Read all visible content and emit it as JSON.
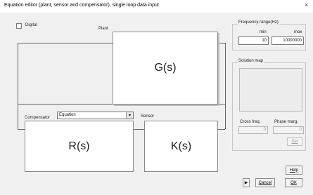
{
  "window": {
    "title": "Equation editor (plant, sensor and compensator), single loop data input",
    "close_glyph": "×"
  },
  "options": {
    "digital_label": "Digital",
    "digital_checked": false
  },
  "diagram": {
    "plant_label": "Plant",
    "plant_block": "G(s)",
    "compensator_label": "Compensator",
    "compensator_type": "Equation",
    "compensator_block": "R(s)",
    "sensor_label": "Sensor",
    "sensor_block": "K(s)"
  },
  "frequency_range": {
    "title": "Frequency range(Hz)",
    "min_label": "min",
    "max_label": "max",
    "min_value": "10",
    "max_value": "10000000"
  },
  "solution_map": {
    "title": "Solution map",
    "cross_freq_label": "Cross freq.",
    "phase_marg_label": "Phase marg.",
    "cross_freq_value": "0",
    "phase_marg_value": "0",
    "set_label": "Set"
  },
  "buttons": {
    "help_label": "Help",
    "run_glyph": "▶",
    "cancel_label": "Cancel",
    "ok_label": "OK"
  }
}
